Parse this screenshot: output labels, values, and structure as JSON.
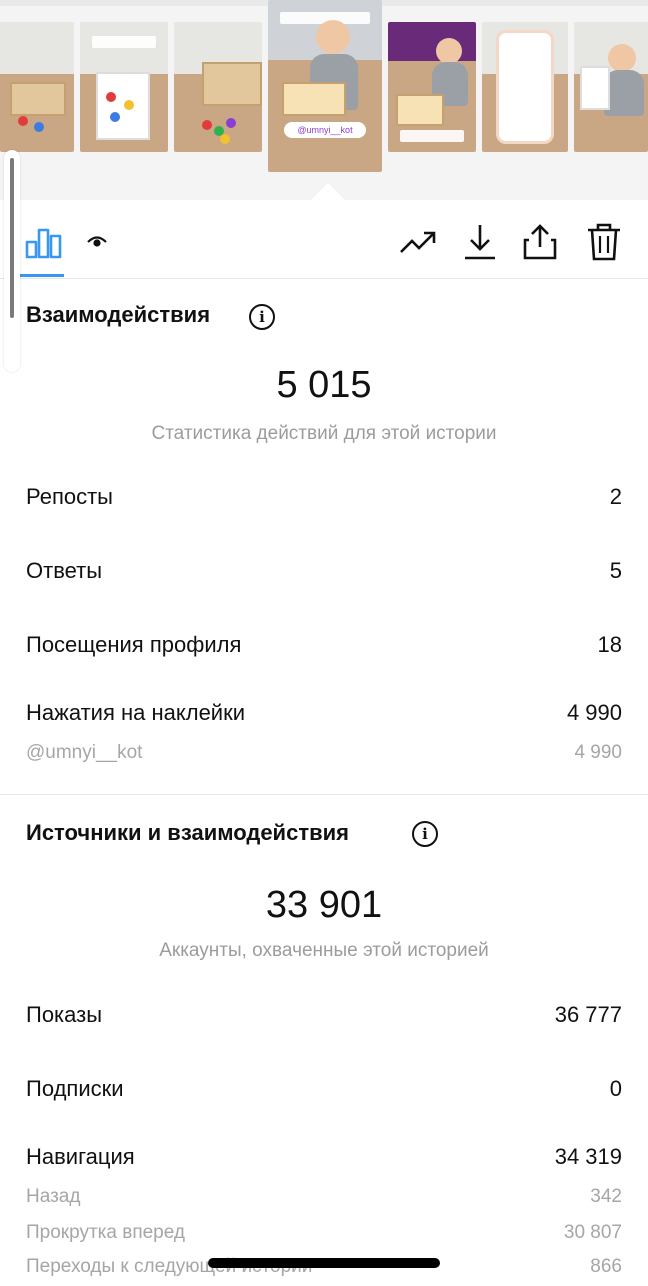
{
  "thumbnail_strip": {
    "selected_story_label": "@umnyi__kot",
    "thumbnail_count": 7
  },
  "toolbar": {
    "tabs": [
      {
        "icon": "bar-chart-icon",
        "active": true
      },
      {
        "icon": "eye-icon",
        "active": false
      }
    ],
    "actions": [
      "trending-icon",
      "download-icon",
      "share-icon",
      "trash-icon"
    ]
  },
  "interactions": {
    "title": "Взаимодействия",
    "total": "5 015",
    "caption": "Статистика действий для этой истории",
    "rows": [
      {
        "label": "Репосты",
        "value": "2"
      },
      {
        "label": "Ответы",
        "value": "5"
      },
      {
        "label": "Посещения профиля",
        "value": "18"
      },
      {
        "label": "Нажатия на наклейки",
        "value": "4 990"
      },
      {
        "label": "@umnyi__kot",
        "value": "4 990",
        "sub": true
      }
    ]
  },
  "discovery": {
    "title": "Источники и взаимодействия",
    "total": "33 901",
    "caption": "Аккаунты, охваченные этой историей",
    "rows": [
      {
        "label": "Показы",
        "value": "36 777"
      },
      {
        "label": "Подписки",
        "value": "0"
      },
      {
        "label": "Навигация",
        "value": "34 319"
      },
      {
        "label": "Назад",
        "value": "342",
        "sub": true
      },
      {
        "label": "Прокрутка вперед",
        "value": "30 807",
        "sub": true
      },
      {
        "label": "Переходы к следующей истории",
        "value": "866",
        "sub": true
      }
    ]
  },
  "colors": {
    "accent": "#3897f0",
    "muted_text": "#9c9c9c",
    "sub_text": "#a6a6a6"
  }
}
